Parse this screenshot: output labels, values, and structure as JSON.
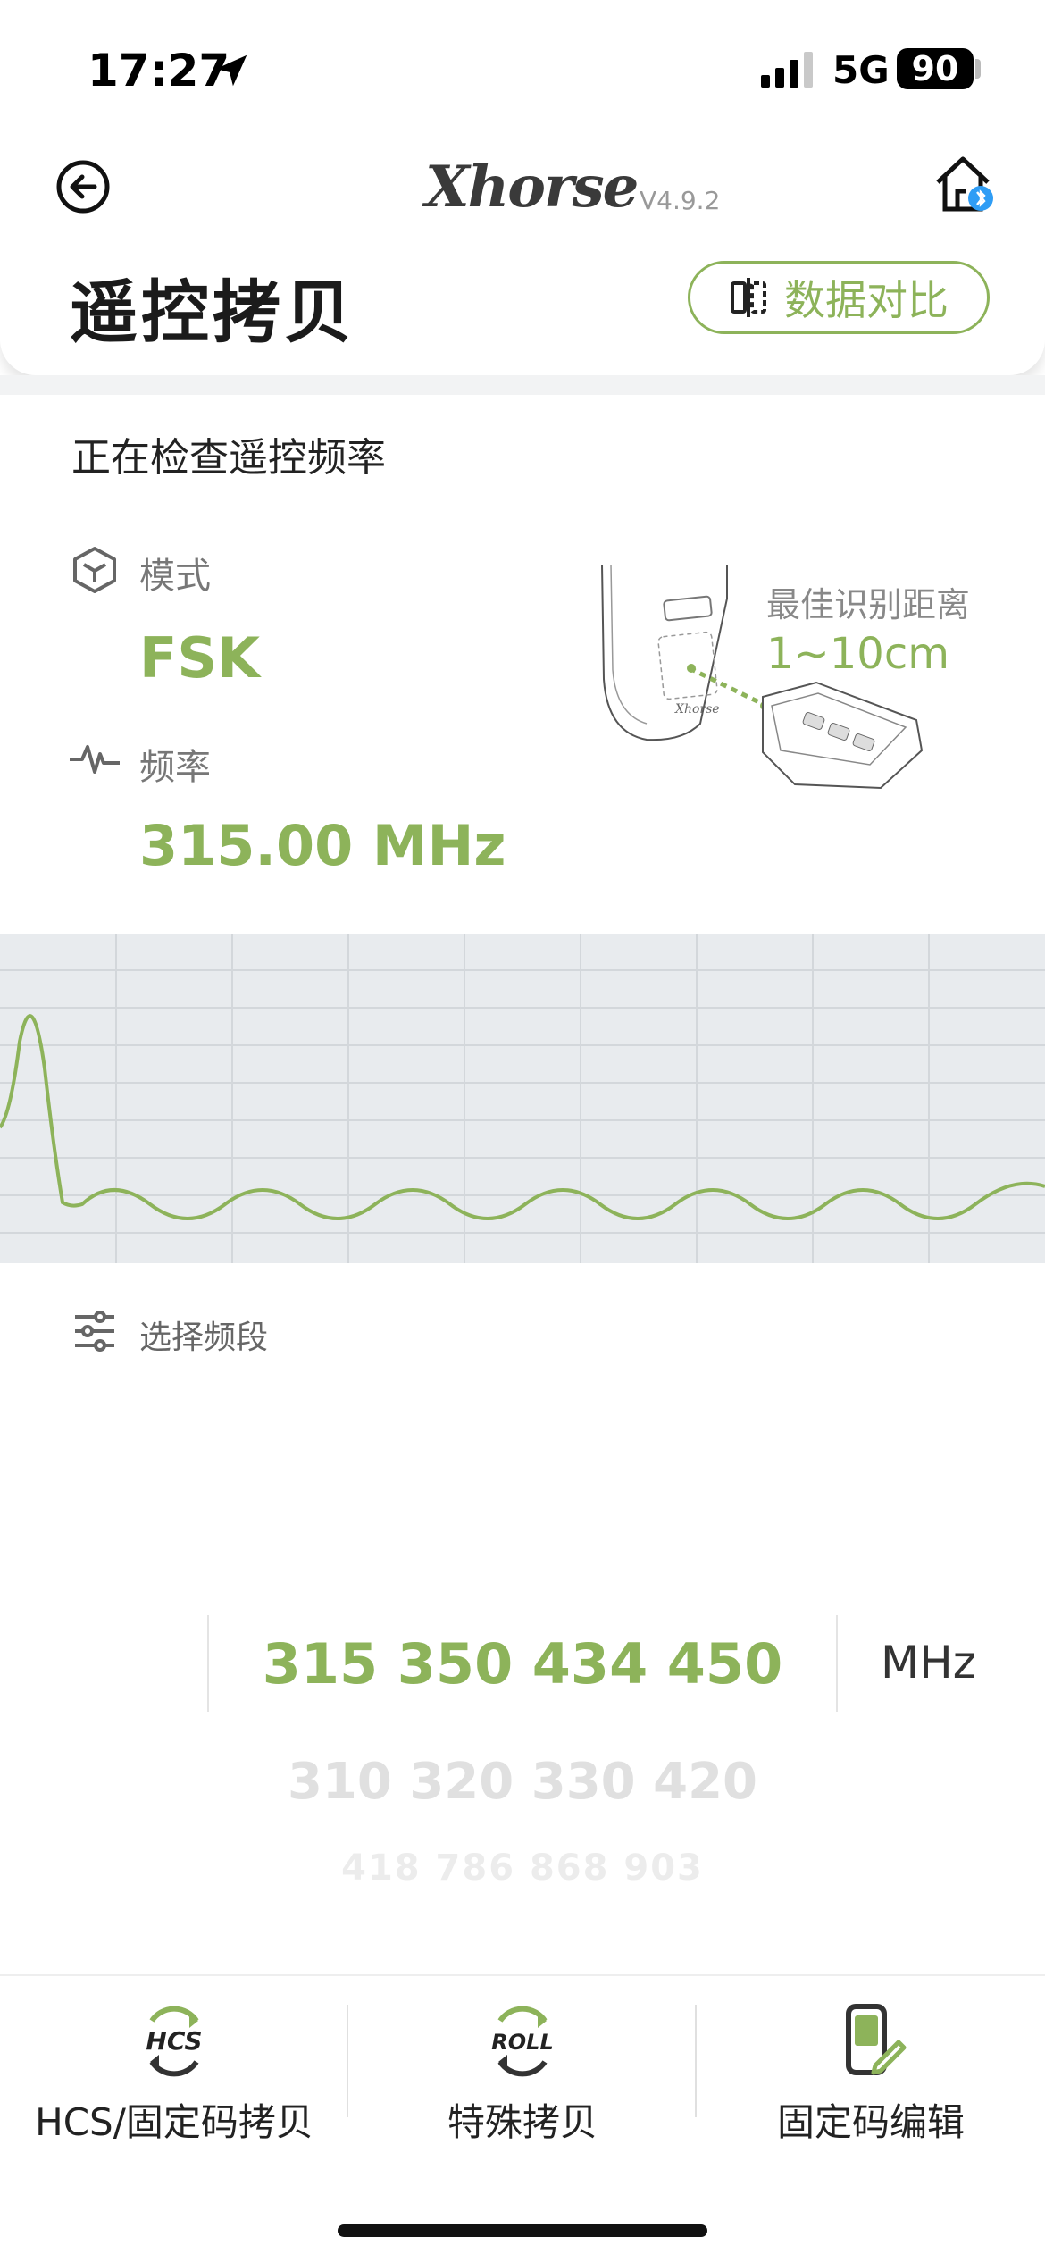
{
  "status_bar": {
    "time": "17:27",
    "network": "5G",
    "battery": "90",
    "icons": [
      "location-arrow-icon",
      "signal-icon"
    ]
  },
  "header": {
    "logo": "Xhorse",
    "version": "V4.9.2",
    "title": "遥控拷贝",
    "compare_button": "数据对比",
    "icons": [
      "back-icon",
      "home-bluetooth-icon",
      "compare-icon"
    ]
  },
  "main": {
    "checking_text": "正在检查遥控频率",
    "mode": {
      "label": "模式",
      "value": "FSK",
      "icon": "cube-icon"
    },
    "frequency": {
      "label": "频率",
      "value": "315.00 MHz",
      "icon": "waveform-icon"
    },
    "best_distance": {
      "label": "最佳识别距离",
      "value": "1~10cm"
    }
  },
  "band_selector": {
    "label": "选择频段",
    "icon": "sliders-icon",
    "rows": [
      "315 350 434 450",
      "310 320 330 420",
      "418 786 868 903",
      ""
    ],
    "unit": "MHz"
  },
  "tabs": [
    {
      "icon_text": "HCS",
      "label": "HCS/固定码拷贝"
    },
    {
      "icon_text": "ROLL",
      "label": "特殊拷贝"
    },
    {
      "icon_text": "",
      "label": "固定码编辑"
    }
  ],
  "colors": {
    "accent": "#8db35a",
    "chart_bg": "#e8ebee"
  }
}
